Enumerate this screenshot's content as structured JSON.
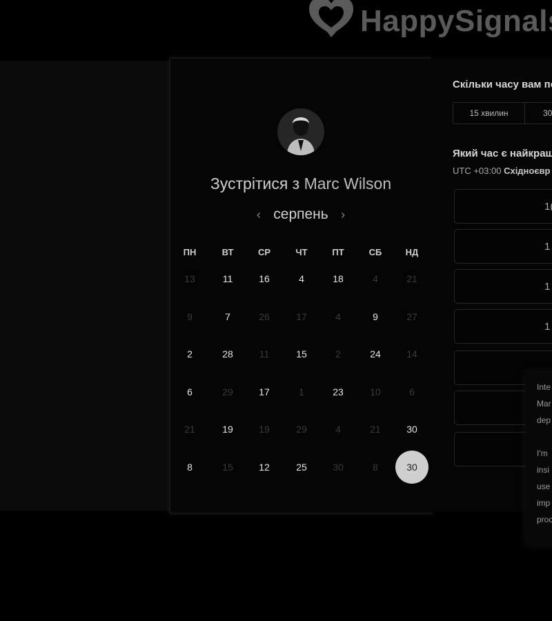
{
  "brand": {
    "name": "HappySignals"
  },
  "scheduler": {
    "title_prefix": "Зустрітися з",
    "host_name": "Marc Wilson",
    "month": "серпень",
    "weekdays": [
      "ПН",
      "ВТ",
      "СР",
      "ЧТ",
      "ПТ",
      "СБ",
      "НД"
    ],
    "weeks": [
      [
        {
          "d": "13",
          "muted": true
        },
        {
          "d": "11"
        },
        {
          "d": "16"
        },
        {
          "d": "4"
        },
        {
          "d": "18"
        },
        {
          "d": "4",
          "muted": true
        },
        {
          "d": "21",
          "muted": true
        }
      ],
      [
        {
          "d": "9",
          "muted": true
        },
        {
          "d": "7"
        },
        {
          "d": "26",
          "muted": true
        },
        {
          "d": "17",
          "muted": true
        },
        {
          "d": "4",
          "muted": true
        },
        {
          "d": "9"
        },
        {
          "d": "27",
          "muted": true
        }
      ],
      [
        {
          "d": "2"
        },
        {
          "d": "28"
        },
        {
          "d": "11",
          "muted": true
        },
        {
          "d": "15"
        },
        {
          "d": "2",
          "muted": true
        },
        {
          "d": "24"
        },
        {
          "d": "14",
          "muted": true
        }
      ],
      [
        {
          "d": "6"
        },
        {
          "d": "29",
          "muted": true
        },
        {
          "d": "17"
        },
        {
          "d": "1",
          "muted": true
        },
        {
          "d": "23"
        },
        {
          "d": "10",
          "muted": true
        },
        {
          "d": "6",
          "muted": true
        }
      ],
      [
        {
          "d": "21",
          "muted": true
        },
        {
          "d": "19"
        },
        {
          "d": "19",
          "muted": true
        },
        {
          "d": "29",
          "muted": true
        },
        {
          "d": "4",
          "muted": true
        },
        {
          "d": "21",
          "muted": true
        },
        {
          "d": "30"
        }
      ],
      [
        {
          "d": "8"
        },
        {
          "d": "15",
          "muted": true
        },
        {
          "d": "12"
        },
        {
          "d": "25"
        },
        {
          "d": "30",
          "muted": true
        },
        {
          "d": "8",
          "muted": true
        },
        {
          "d": "30",
          "selected": true
        }
      ]
    ]
  },
  "booking": {
    "duration_question": "Скільки часу вам по",
    "durations": [
      "15 хвилин",
      "30"
    ],
    "time_question": "Який час є найкращ",
    "timezone_offset": "UTC +03:00",
    "timezone_name": "Східноєвр",
    "slots": [
      "1(",
      "1",
      "1",
      "1",
      "",
      "",
      ""
    ]
  },
  "popup": {
    "lines": [
      "Inte",
      "Mar",
      "dep",
      "",
      "I'm",
      "insi",
      "use",
      "imp",
      "proc"
    ]
  }
}
